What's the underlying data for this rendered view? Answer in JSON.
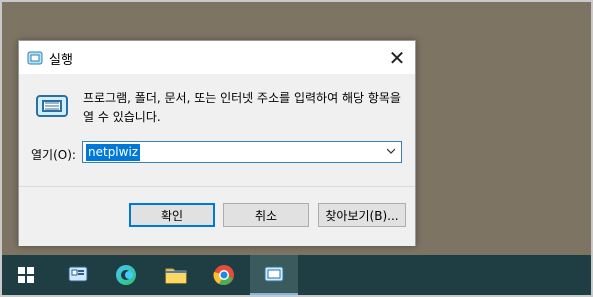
{
  "dialog": {
    "title": "실행",
    "description": "프로그램, 폴더, 문서, 또는 인터넷 주소를 입력하여 해당 항목을 열 수 있습니다.",
    "open_label": "열기(O):",
    "open_value": "netplwiz"
  },
  "buttons": {
    "ok": "확인",
    "cancel": "취소",
    "browse": "찾아보기(B)..."
  },
  "icons": {
    "run": "run-icon",
    "close": "close-icon",
    "dropdown": "chevron-down-icon"
  },
  "taskbar": {
    "items": [
      "start-button",
      "control-panel",
      "edge",
      "file-explorer",
      "chrome",
      "run"
    ]
  },
  "colors": {
    "desktop": "#7d7464",
    "taskbar": "#1e3e43",
    "accent": "#0078d7"
  }
}
